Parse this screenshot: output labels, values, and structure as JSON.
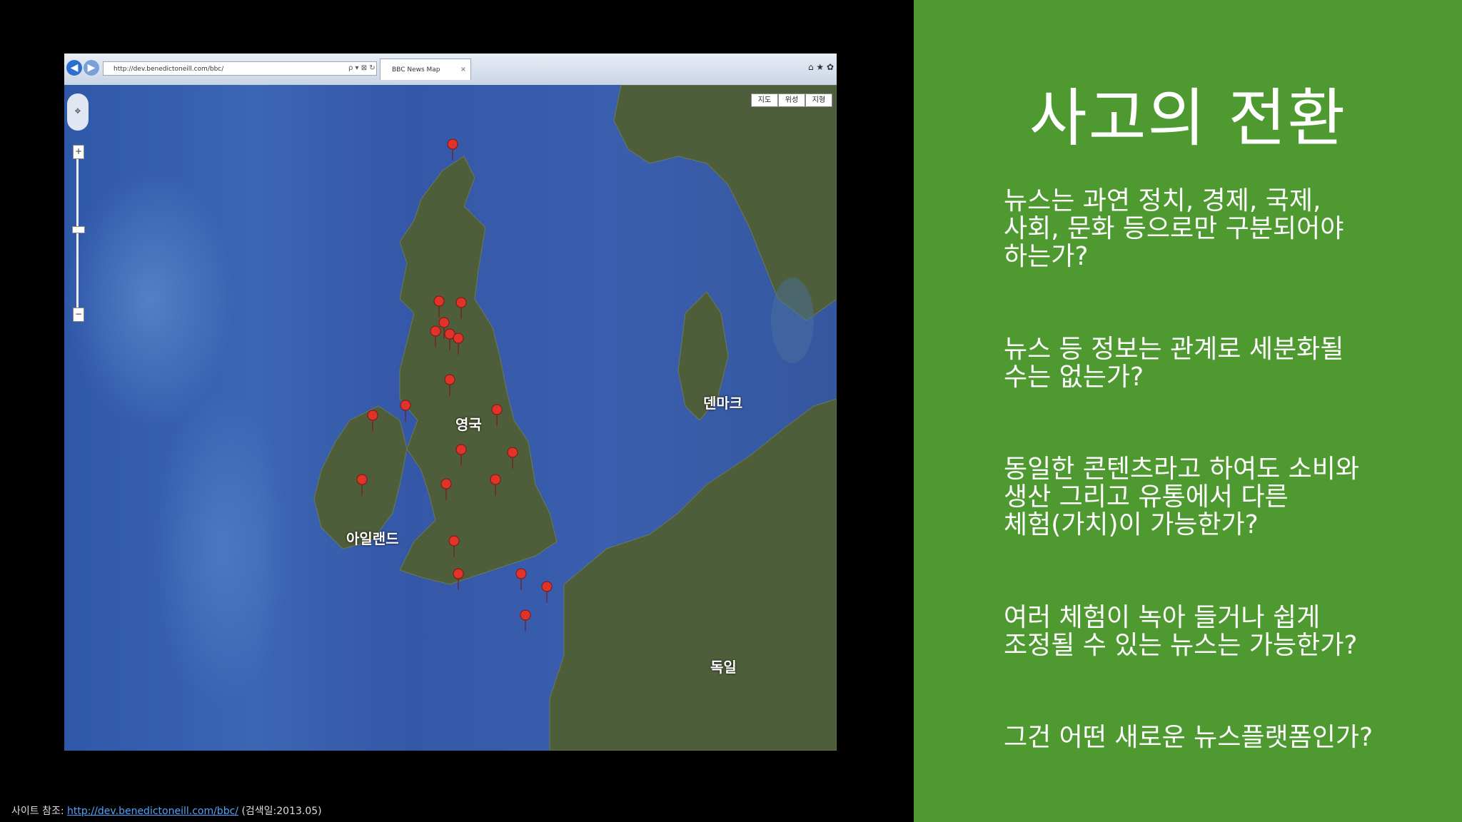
{
  "slide": {
    "title": "사고의 전환",
    "questions": [
      "뉴스는 과연 정치, 경제, 국제,\n사회, 문화 등으로만 구분되어야\n하는가?",
      "뉴스 등 정보는 관계로 세분화될\n수는 없는가?",
      "동일한 콘텐츠라고 하여도 소비와\n생산 그리고 유통에서 다른\n체험(가치)이 가능한가?",
      "여러 체험이 녹아 들거나 쉽게\n조정될 수 있는 뉴스는 가능한가?",
      "그건 어떤 새로운 뉴스플랫폼인가?"
    ],
    "background_color": "#4e9a31"
  },
  "browser": {
    "address": "http://dev.benedictoneill.com/bbc/",
    "tab_title": "BBC News Map",
    "address_icons": "ρ ▾ ⊠ ↻",
    "back_icon": "back-arrow-icon",
    "forward_icon": "forward-arrow-icon"
  },
  "map": {
    "map_types": [
      "지도",
      "위성",
      "지형"
    ],
    "labels": {
      "uk": "영국",
      "ireland": "아일랜드",
      "denmark": "덴마크",
      "germany": "독일"
    },
    "marker_color": "#e0342a"
  },
  "citation": {
    "prefix": "사이트 참조: ",
    "link": "http://dev.benedictoneill.com/bbc/",
    "suffix": " (검색일:2013.05)"
  }
}
